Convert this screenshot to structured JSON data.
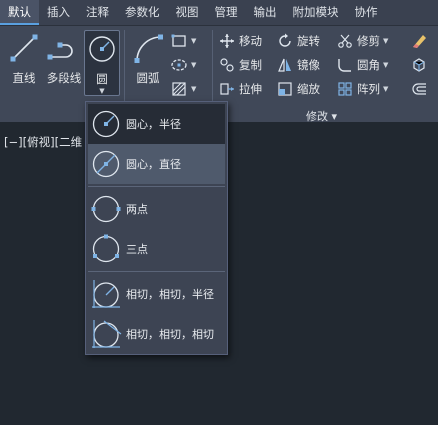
{
  "tabs": [
    "默认",
    "插入",
    "注释",
    "参数化",
    "视图",
    "管理",
    "输出",
    "附加模块",
    "协作"
  ],
  "draw": {
    "line_label": "直线",
    "polyline_label": "多段线",
    "circle_label": "圆",
    "arc_label": "圆弧"
  },
  "modify": {
    "move": "移动",
    "rotate": "旋转",
    "trim": "修剪",
    "copy": "复制",
    "mirror": "镜像",
    "fillet": "圆角",
    "stretch": "拉伸",
    "scale": "缩放",
    "array": "阵列",
    "group_label": "修改 ▾"
  },
  "view_label": "[−][俯视][二维",
  "circle_menu": [
    "圆心，半径",
    "圆心，直径",
    "两点",
    "三点",
    "相切，相切，半径",
    "相切，相切，相切"
  ],
  "colors": {
    "accent": "#5aa0e0",
    "icon_blue": "#7fb4e6",
    "background": "#212830",
    "ribbon": "#404858"
  }
}
